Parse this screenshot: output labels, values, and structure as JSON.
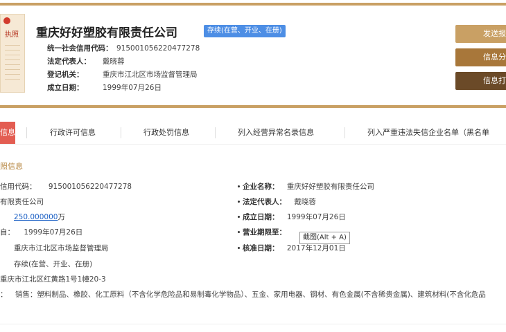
{
  "cert": {
    "label": "执照"
  },
  "company": {
    "name": "重庆好好塑胶有限责任公司",
    "status_tag": "存续(在营、开业、在册)",
    "info": [
      {
        "label": "统一社会信用代码：",
        "value": "915001056220477278"
      },
      {
        "label": "法定代表人：",
        "value": "戴晓蓉"
      },
      {
        "label": "登记机关：",
        "value": "重庆市江北区市场监督管理局"
      },
      {
        "label": "成立日期：",
        "value": "1999年07月26日"
      }
    ]
  },
  "actions": {
    "send_report": "发送报",
    "share": "信息分",
    "print": "信息打"
  },
  "tabs": [
    "信息",
    "行政许可信息",
    "行政处罚信息",
    "列入经营异常名录信息",
    "列入严重违法失信企业名单（黑名单"
  ],
  "section": {
    "title": "照信息"
  },
  "details": {
    "credit_code_label": "信用代码：",
    "credit_code": "915001056220477278",
    "company_name_label": "企业名称：",
    "company_name": "重庆好好塑胶有限责任公司",
    "type_value": "有限责任公司",
    "legal_rep_label": "法定代表人：",
    "legal_rep": "戴晓蓉",
    "capital": "250.000000",
    "capital_unit": "万",
    "established_label": "成立日期：",
    "established": "1999年07月26日",
    "from_label": "自：",
    "from_date": "1999年07月26日",
    "term_label": "营业期限至：",
    "authority_label": "登记机关：",
    "authority_value": "重庆市江北区市场监督管理局",
    "approved_label": "核准日期：",
    "approved": "2017年12月01日",
    "status_value": "存续(在营、开业、在册)",
    "address": "重庆市江北区红黄路1号1幢20-3",
    "scope_prefix": "：",
    "scope": "销售：塑料制品、橡胶、化工原料（不含化学危险品和易制毒化学物品）、五金、家用电器、钢材、有色金属(不含稀贵金属)、建筑材料(不含化危品"
  },
  "tooltip": "截图(Alt + A)"
}
